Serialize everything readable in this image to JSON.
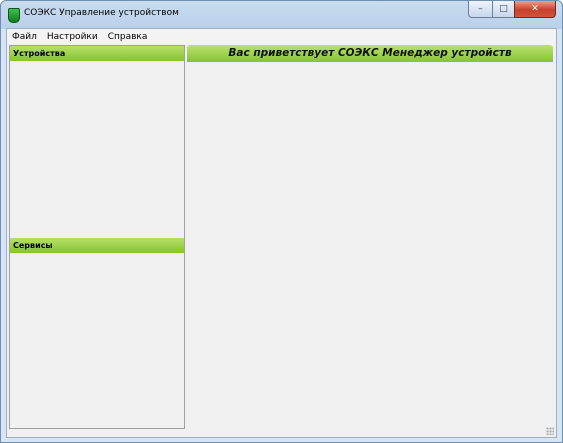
{
  "window": {
    "title": "СОЭКС Управление устройством",
    "controls": {
      "minimize": "–",
      "maximize": "□",
      "close": "✕"
    }
  },
  "menu": {
    "items": [
      {
        "label": "Файл"
      },
      {
        "label": "Настройки"
      },
      {
        "label": "Справка"
      }
    ]
  },
  "sidebar": {
    "devices_header": "Устройства",
    "services_header": "Сервисы"
  },
  "main": {
    "welcome": "Вас приветствует СОЭКС Менеджер устройств"
  },
  "colors": {
    "accent_green": "#86c431",
    "app_icon_green": "#127b21"
  }
}
